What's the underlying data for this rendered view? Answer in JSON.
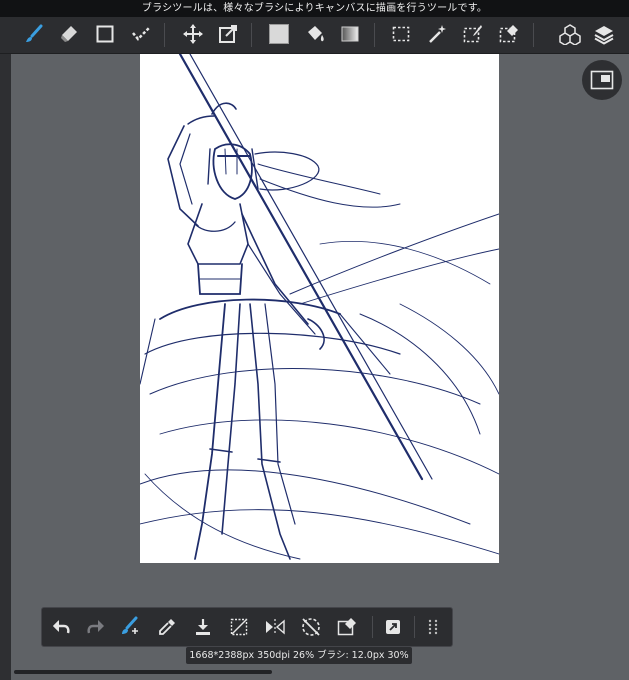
{
  "hint_text": "ブラシツールは、様々なブラシによりキャンバスに描画を行うツールです。",
  "status_text": "1668*2388px 350dpi 26% ブラシ: 12.0px 30%",
  "colors": {
    "accent": "#3a9ee0",
    "toolbar_bg": "#2c2d30",
    "workspace_bg": "#5f6266",
    "sketch_stroke": "#1f2d6b"
  },
  "top_toolbar": {
    "tools": [
      {
        "name": "brush-tool",
        "icon": "brush-icon",
        "active": true
      },
      {
        "name": "eraser-tool",
        "icon": "eraser-icon"
      },
      {
        "name": "shape-tool",
        "icon": "square-outline-icon"
      },
      {
        "name": "correction-tool",
        "icon": "stroke-correction-icon"
      },
      {
        "name": "move-tool",
        "icon": "move-arrows-icon"
      },
      {
        "name": "transform-tool",
        "icon": "transform-icon"
      },
      {
        "name": "fill-color",
        "icon": "color-swatch-icon"
      },
      {
        "name": "bucket-tool",
        "icon": "paint-bucket-icon"
      },
      {
        "name": "gradation-tool",
        "icon": "gradient-icon"
      },
      {
        "name": "select-tool",
        "icon": "marquee-select-icon"
      },
      {
        "name": "magic-wand-tool",
        "icon": "magic-wand-icon"
      },
      {
        "name": "select-pen-tool",
        "icon": "selection-pen-icon"
      },
      {
        "name": "select-eraser-tool",
        "icon": "selection-eraser-icon"
      },
      {
        "name": "materials",
        "icon": "cubes-icon"
      },
      {
        "name": "layers",
        "icon": "layers-icon"
      }
    ]
  },
  "bottom_toolbar": {
    "tools": [
      {
        "name": "undo",
        "icon": "undo-icon"
      },
      {
        "name": "redo",
        "icon": "redo-icon",
        "disabled": true
      },
      {
        "name": "brush-settings",
        "icon": "brush-settings-icon"
      },
      {
        "name": "eyedropper",
        "icon": "eyedropper-icon"
      },
      {
        "name": "save",
        "icon": "save-download-icon"
      },
      {
        "name": "clear",
        "icon": "clear-canvas-icon"
      },
      {
        "name": "flip",
        "icon": "flip-horizontal-icon"
      },
      {
        "name": "rotate-reset",
        "icon": "rotate-reset-icon"
      },
      {
        "name": "transform-selection",
        "icon": "select-transform-icon"
      },
      {
        "name": "quick-access",
        "icon": "quick-access-icon"
      },
      {
        "name": "more",
        "icon": "grid-dots-icon"
      }
    ]
  }
}
